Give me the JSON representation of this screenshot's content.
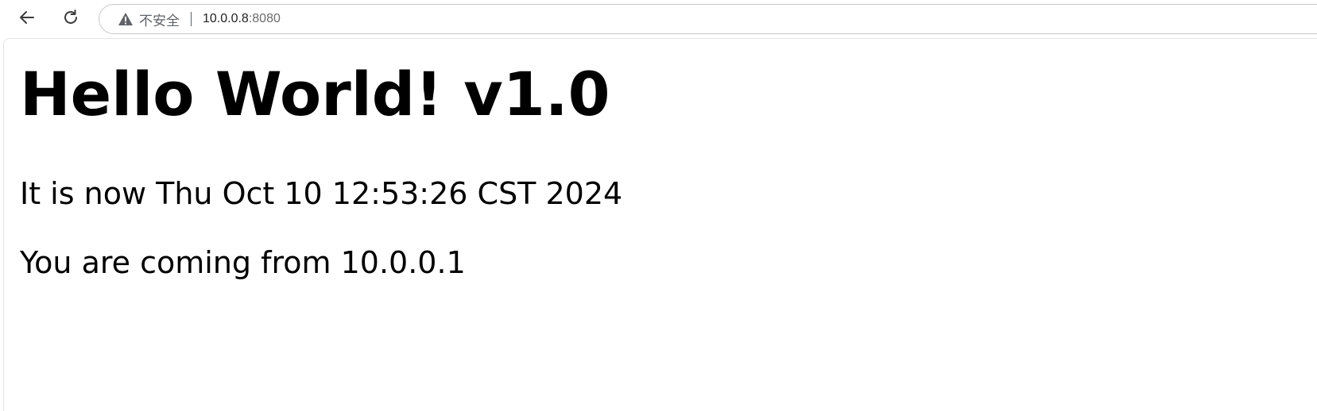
{
  "toolbar": {
    "back_icon": "arrow-left-icon",
    "reload_icon": "reload-icon",
    "address": {
      "warning_icon": "warning-triangle-icon",
      "security_label": "不安全",
      "url_host": "10.0.0.8",
      "url_port": ":8080"
    }
  },
  "page": {
    "heading": "Hello World! v1.0",
    "time_text": "It is now Thu Oct 10 12:53:26 CST 2024",
    "origin_text": "You are coming from 10.0.0.1"
  },
  "colors": {
    "toolbar_bg": "#ffffff",
    "address_border": "#c8c8c8",
    "security_text": "#5f6368",
    "url_port": "#6b6b6b",
    "page_text": "#000000"
  }
}
